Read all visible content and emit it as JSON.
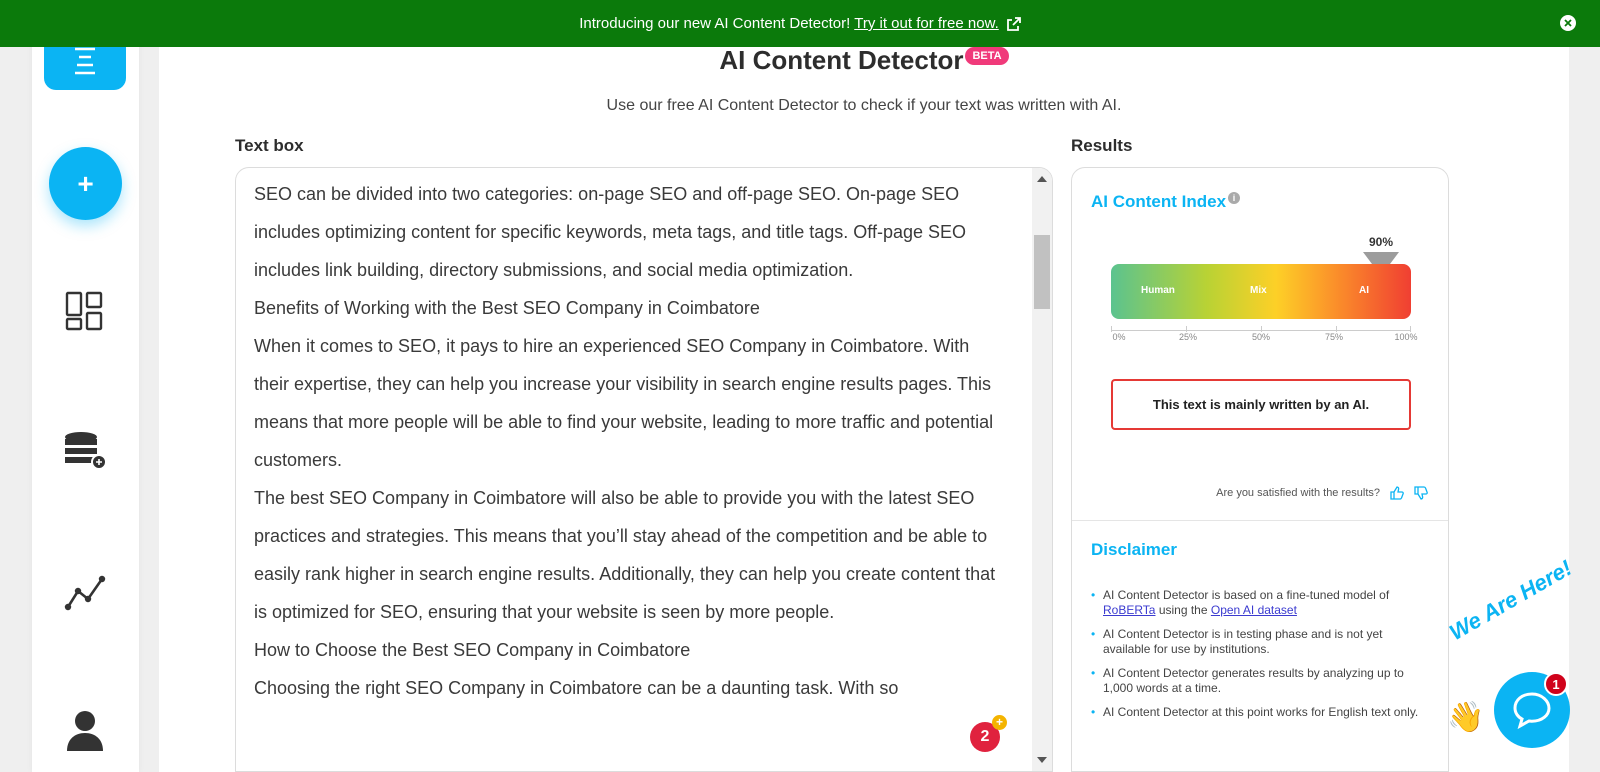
{
  "banner": {
    "text": "Introducing our new AI Content Detector!",
    "link": "Try it out for free now."
  },
  "page": {
    "title": "AI Content Detector",
    "beta": "BETA",
    "subtitle": "Use our free AI Content Detector to check if your text was written with AI."
  },
  "textbox": {
    "label": "Text box",
    "paragraphs": [
      "SEO can be divided into two categories: on-page SEO and off-page SEO. On-page SEO includes optimizing content for specific keywords, meta tags, and title tags. Off-page SEO includes link building, directory submissions, and social media optimization.",
      "Benefits of Working with the Best SEO Company in Coimbatore",
      "When it comes to SEO, it pays to hire an experienced SEO Company in Coimbatore. With their expertise, they can help you increase your visibility in search engine results pages. This means that more people will be able to find your website, leading to more traffic and potential customers.",
      "The best SEO Company in Coimbatore will also be able to provide you with the latest SEO practices and strategies. This means that you’ll stay ahead of the competition and be able to easily rank higher in search engine results. Additionally, they can help you create content that is optimized for SEO, ensuring that your website is seen by more people.",
      "How to Choose the Best SEO Company in Coimbatore",
      "Choosing the right SEO Company in Coimbatore can be a daunting task. With so"
    ],
    "badge_count": "2",
    "badge_plus": "+"
  },
  "results": {
    "label": "Results",
    "index_title": "AI Content Index",
    "info": "i",
    "gauge_value": 0.9,
    "gauge_value_label": "90%",
    "gauge_labels": [
      "Human",
      "Mix",
      "AI"
    ],
    "ticks": [
      "0%",
      "25%",
      "50%",
      "75%",
      "100%"
    ],
    "verdict": "This text is mainly written by an AI.",
    "satisfied": "Are you satisfied with the results?",
    "disclaimer_title": "Disclaimer",
    "disclaimer": {
      "item1_pre": "AI Content Detector is based on a fine-tuned model of",
      "item1_link1": "RoBERTa",
      "item1_mid": "using the",
      "item1_link2": "Open AI dataset",
      "item2": "AI Content Detector is in testing phase and is not yet available for use by institutions.",
      "item3": "AI Content Detector generates results by analyzing up to 1,000 words at a time.",
      "item4": "AI Content Detector at this point works for English text only."
    }
  },
  "sidebar": {
    "add": "+"
  },
  "chat": {
    "text": "We Are Here!",
    "badge": "1"
  },
  "colors": {
    "banner": "#0b7a0b",
    "accent": "#0bb4f3",
    "verdict_border": "#e53935",
    "beta": "#f03a7a"
  }
}
